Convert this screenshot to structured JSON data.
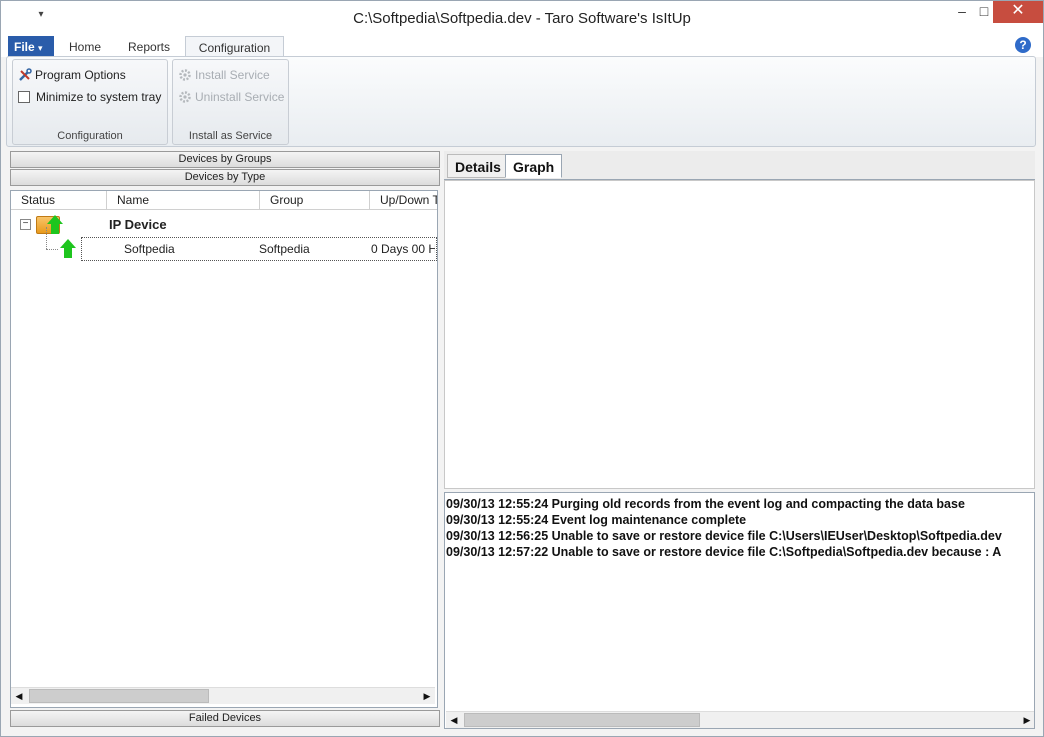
{
  "window": {
    "title": "C:\\Softpedia\\Softpedia.dev - Taro Software's IsItUp",
    "qat_icon": "qat-dropdown-icon",
    "controls": {
      "minimize": "–",
      "maximize": "□",
      "close": "✕"
    }
  },
  "ribbon": {
    "file_tab": "File",
    "tabs": [
      "Home",
      "Reports",
      "Configuration"
    ],
    "active_tab": "Configuration",
    "help": "?",
    "groups": [
      {
        "label": "Configuration",
        "items": [
          {
            "label": "Program Options",
            "icon": "tools-icon",
            "enabled": true
          },
          {
            "label": "Minimize to system tray",
            "type": "checkbox",
            "checked": false
          }
        ]
      },
      {
        "label": "Install as Service",
        "items": [
          {
            "label": "Install Service",
            "icon": "gear-icon",
            "enabled": false
          },
          {
            "label": "Uninstall Service",
            "icon": "gear-icon",
            "enabled": false
          }
        ]
      }
    ]
  },
  "left_panel": {
    "nav_groups": "Devices by Groups",
    "nav_type": "Devices by Type",
    "nav_failed": "Failed Devices",
    "columns": [
      "Status",
      "Name",
      "Group",
      "Up/Down T"
    ],
    "tree": {
      "group_label": "IP Device",
      "expander": "−",
      "devices": [
        {
          "name": "Softpedia",
          "group": "Softpedia",
          "updown": "0 Days 00 H",
          "status": "up"
        }
      ]
    }
  },
  "right_panel": {
    "tabs": [
      "Details",
      "Graph"
    ],
    "active_tab": "Graph",
    "log": [
      "09/30/13 12:55:24 Purging old records from the event log and compacting the data base",
      "09/30/13 12:55:24 Event log maintenance complete",
      "09/30/13 12:56:25 Unable to save or restore device file C:\\Users\\IEUser\\Desktop\\Softpedia.dev",
      "09/30/13 12:57:22 Unable to save or restore device file C:\\Softpedia\\Softpedia.dev because : A"
    ]
  },
  "colors": {
    "file_tab": "#2a5caa",
    "close_button": "#c74d3f",
    "status_up": "#1ec51e"
  }
}
